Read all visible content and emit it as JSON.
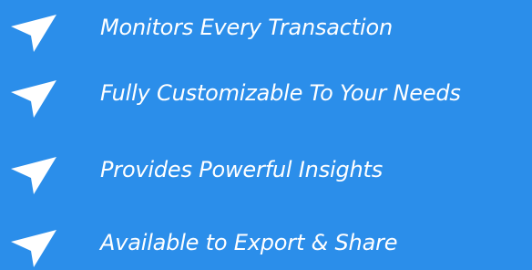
{
  "features": {
    "items": [
      {
        "label": "Monitors Every Transaction",
        "icon": "send-arrow-icon"
      },
      {
        "label": "Fully Customizable To Your Needs",
        "icon": "send-arrow-icon"
      },
      {
        "label": "Provides Powerful Insights",
        "icon": "send-arrow-icon"
      },
      {
        "label": "Available to Export & Share",
        "icon": "send-arrow-icon"
      }
    ]
  },
  "colors": {
    "background": "#2b8eea",
    "text": "#ffffff",
    "icon": "#ffffff"
  }
}
